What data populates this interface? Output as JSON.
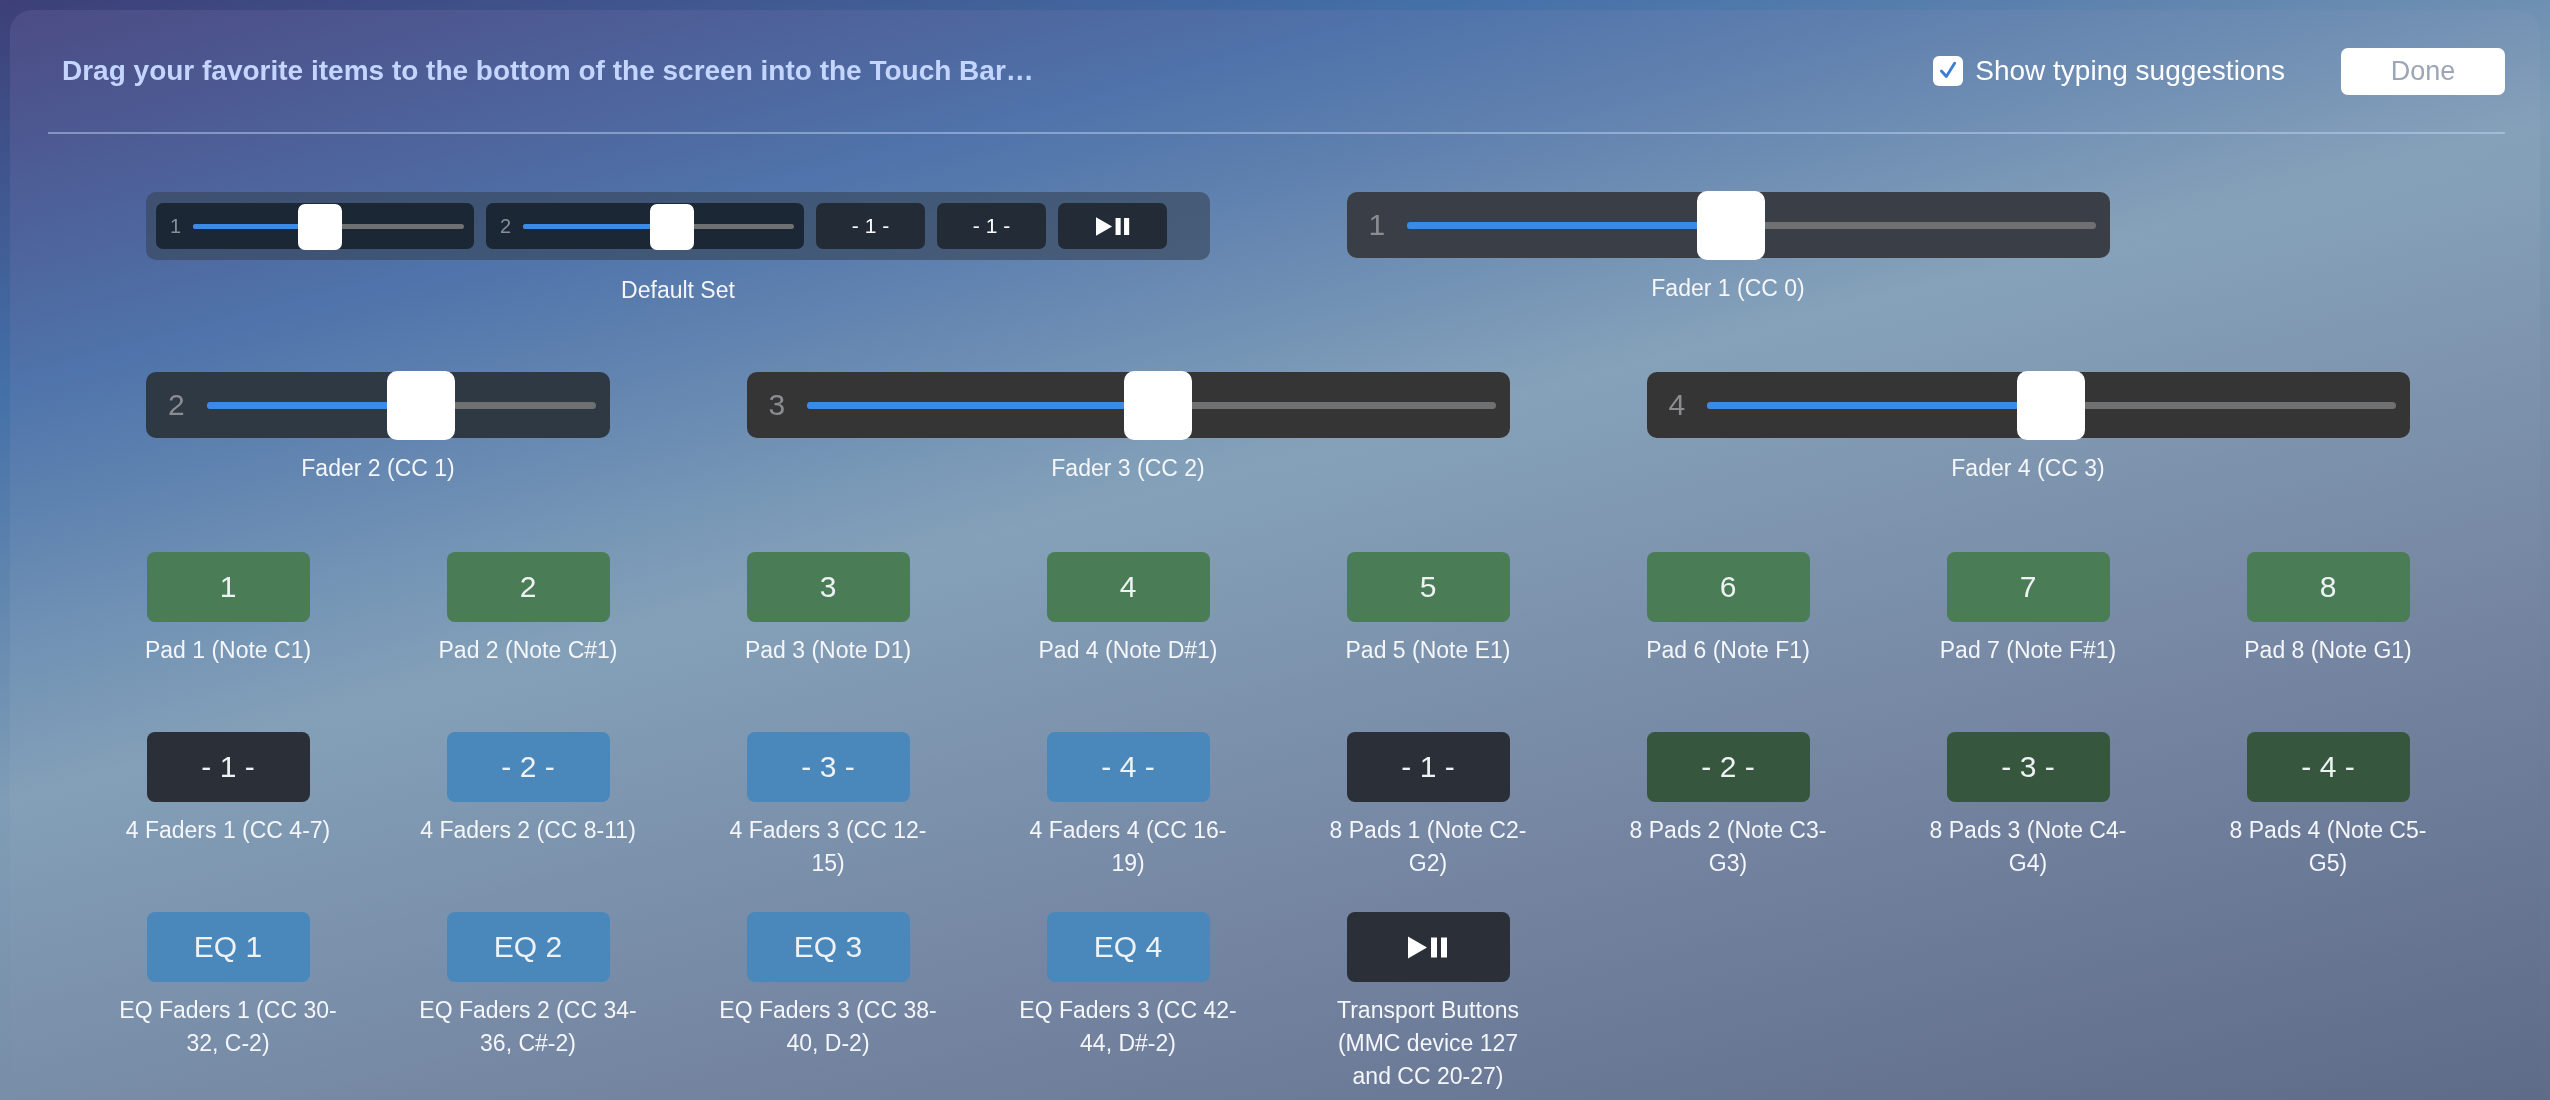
{
  "header": {
    "title": "Drag your favorite items to the bottom of the screen into the Touch Bar…",
    "typing_suggestions": {
      "label": "Show typing suggestions",
      "checked": true
    },
    "done_button": {
      "label": "Done",
      "disabled": true
    }
  },
  "rows": [
    {
      "items": [
        {
          "kind": "set",
          "label": "Default Set",
          "controls": [
            {
              "kind": "slider",
              "number": "1",
              "level": 0.47
            },
            {
              "kind": "slider",
              "number": "2",
              "level": 0.55
            },
            {
              "kind": "button",
              "text": "- 1 -"
            },
            {
              "kind": "button",
              "text": "- 1 -"
            },
            {
              "kind": "transport"
            }
          ]
        },
        {
          "kind": "fader",
          "number": "1",
          "level": 0.47,
          "label": "Fader 1 (CC 0)"
        }
      ]
    },
    {
      "items": [
        {
          "kind": "fader",
          "number": "2",
          "level": 0.55,
          "label": "Fader 2 (CC 1)"
        },
        {
          "kind": "fader",
          "number": "3",
          "level": 0.51,
          "label": "Fader 3 (CC 2)"
        },
        {
          "kind": "fader",
          "number": "4",
          "level": 0.5,
          "label": "Fader 4 (CC 3)"
        }
      ]
    },
    {
      "items": [
        {
          "kind": "button",
          "text": "1",
          "color": "#4a7c56",
          "label": "Pad 1 (Note C1)"
        },
        {
          "kind": "button",
          "text": "2",
          "color": "#4a7c56",
          "label": "Pad 2 (Note C#1)"
        },
        {
          "kind": "button",
          "text": "3",
          "color": "#4a7c56",
          "label": "Pad 3 (Note D1)"
        },
        {
          "kind": "button",
          "text": "4",
          "color": "#4a7c56",
          "label": "Pad 4 (Note D#1)"
        },
        {
          "kind": "button",
          "text": "5",
          "color": "#4a7c56",
          "label": "Pad 5 (Note E1)"
        },
        {
          "kind": "button",
          "text": "6",
          "color": "#4a7c56",
          "label": "Pad 6 (Note F1)"
        },
        {
          "kind": "button",
          "text": "7",
          "color": "#4a7c56",
          "label": "Pad 7 (Note F#1)"
        },
        {
          "kind": "button",
          "text": "8",
          "color": "#4a7c56",
          "label": "Pad 8 (Note G1)"
        }
      ]
    },
    {
      "items": [
        {
          "kind": "button",
          "text": "- 1 -",
          "color": "#2a2f38",
          "label": "4 Faders 1 (CC 4-7)"
        },
        {
          "kind": "button",
          "text": "- 2 -",
          "color": "#4a88bb",
          "label": "4 Faders 2 (CC 8-11)"
        },
        {
          "kind": "button",
          "text": "- 3 -",
          "color": "#4a88bb",
          "label": "4 Faders 3 (CC 12-15)"
        },
        {
          "kind": "button",
          "text": "- 4 -",
          "color": "#4a88bb",
          "label": "4 Faders 4 (CC 16-19)"
        },
        {
          "kind": "button",
          "text": "- 1 -",
          "color": "#2a2f38",
          "label": "8 Pads 1 (Note C2-G2)"
        },
        {
          "kind": "button",
          "text": "- 2 -",
          "color": "#36573d",
          "label": "8 Pads 2 (Note C3-G3)"
        },
        {
          "kind": "button",
          "text": "- 3 -",
          "color": "#36573d",
          "label": "8 Pads 3 (Note C4-G4)"
        },
        {
          "kind": "button",
          "text": "- 4 -",
          "color": "#36573d",
          "label": "8 Pads 4 (Note C5-G5)"
        }
      ]
    },
    {
      "items": [
        {
          "kind": "button",
          "text": "EQ 1",
          "color": "#4a88bb",
          "label": "EQ Faders 1 (CC 30-32, C-2)"
        },
        {
          "kind": "button",
          "text": "EQ 2",
          "color": "#4a88bb",
          "label": "EQ Faders 2 (CC 34-36, C#-2)"
        },
        {
          "kind": "button",
          "text": "EQ 3",
          "color": "#4a88bb",
          "label": "EQ Faders 3 (CC 38-40, D-2)"
        },
        {
          "kind": "button",
          "text": "EQ 4",
          "color": "#4a88bb",
          "label": "EQ Faders 3 (CC 42-44, D#-2)"
        },
        {
          "kind": "transport",
          "color": "#2a2f38",
          "label": "Transport Buttons (MMC device 127 and CC 20-27)"
        }
      ]
    }
  ]
}
